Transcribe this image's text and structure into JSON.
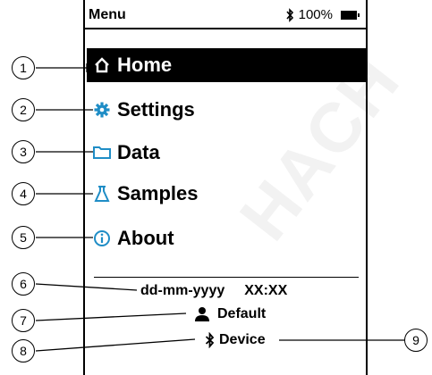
{
  "status": {
    "title": "Menu",
    "battery": "100%"
  },
  "menu": [
    {
      "label": "Home",
      "icon": "home-icon",
      "active": true
    },
    {
      "label": "Settings",
      "icon": "gear-icon",
      "active": false
    },
    {
      "label": "Data",
      "icon": "folder-icon",
      "active": false
    },
    {
      "label": "Samples",
      "icon": "flask-icon",
      "active": false
    },
    {
      "label": "About",
      "icon": "info-icon",
      "active": false
    }
  ],
  "info": {
    "date": "dd-mm-yyyy",
    "time": "XX:XX",
    "user": "Default",
    "device": "Device"
  },
  "callouts": [
    "1",
    "2",
    "3",
    "4",
    "5",
    "6",
    "7",
    "8",
    "9"
  ],
  "colors": {
    "accent": "#1f8dc6",
    "active_bg": "#000000"
  }
}
